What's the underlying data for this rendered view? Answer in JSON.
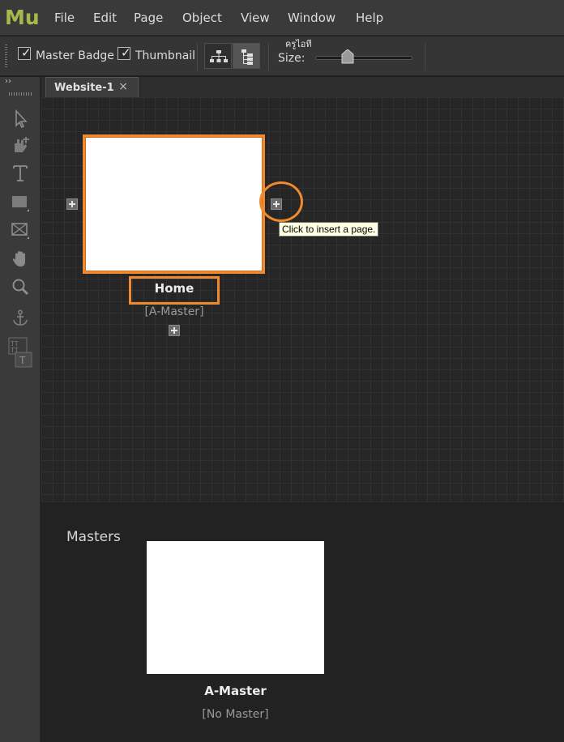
{
  "app": {
    "logo": "Mu"
  },
  "menu": [
    "File",
    "Edit",
    "Page",
    "Object",
    "View",
    "Window",
    "Help"
  ],
  "toolbar": {
    "master_badge_label": "Master Badge",
    "master_badge_checked": true,
    "thumbnail_label": "Thumbnail",
    "thumbnail_checked": true,
    "thai_caption": "ครูไอที",
    "size_label": "Size:",
    "check_glyph": "✓"
  },
  "tool_panel": {
    "collapse_glyph": "››"
  },
  "tab": {
    "title": "Website-1",
    "close_glyph": "×"
  },
  "plan": {
    "page_name": "Home",
    "page_master": "[A-Master]",
    "tooltip": "Click to insert a page."
  },
  "masters": {
    "title": "Masters",
    "master_name": "A-Master",
    "master_of": "[No Master]"
  },
  "colors": {
    "accent_orange": "#f08a2c",
    "logo_green": "#a9b84a",
    "tooltip_bg": "#ffffe1"
  }
}
